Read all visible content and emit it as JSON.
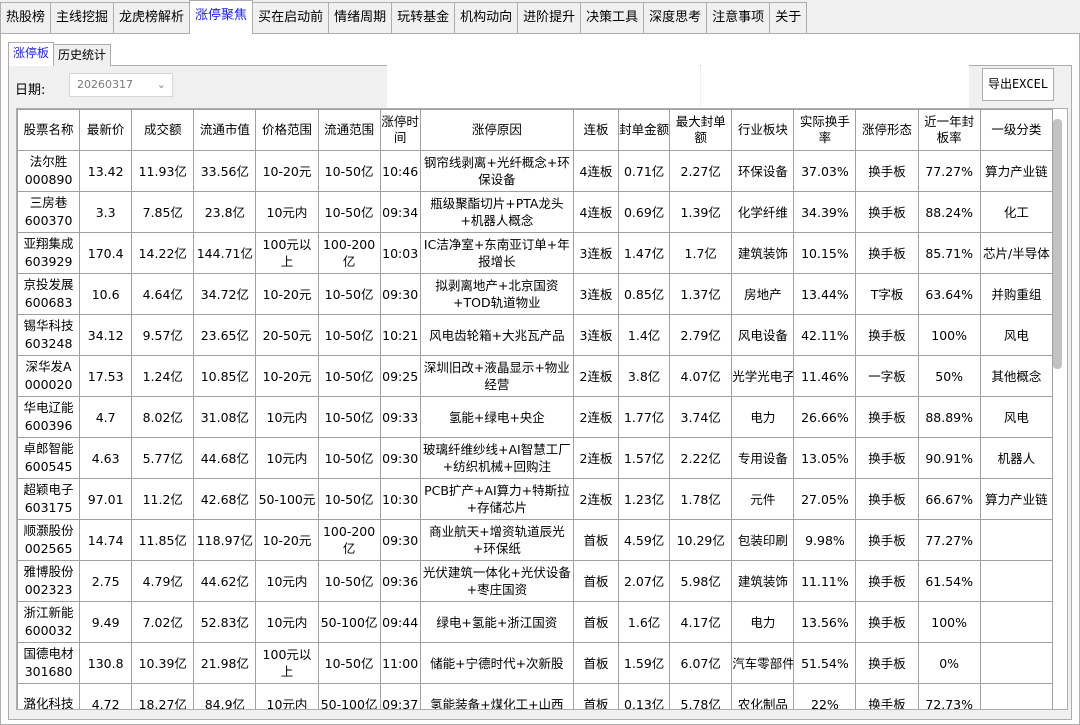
{
  "main_tabs": [
    "热股榜",
    "主线挖掘",
    "龙虎榜解析",
    "涨停聚焦",
    "买在启动前",
    "情绪周期",
    "玩转基金",
    "机构动向",
    "进阶提升",
    "决策工具",
    "深度思考",
    "注意事项",
    "关于"
  ],
  "active_main_tab": 3,
  "sub_tabs": [
    "涨停板",
    "历史统计"
  ],
  "active_sub_tab": 0,
  "date_label": "日期:",
  "date_value": "20260317",
  "export_label": "导出EXCEL",
  "columns": [
    "股票名称",
    "最新价",
    "成交额",
    "流通市值",
    "价格范围",
    "流通范围",
    "涨停时间",
    "涨停原因",
    "连板",
    "封单金额",
    "最大封单额",
    "行业板块",
    "实际换手率",
    "涨停形态",
    "近一年封板率",
    "一级分类"
  ],
  "rows": [
    [
      "法尔胜",
      "000890",
      "13.42",
      "11.93亿",
      "33.56亿",
      "10-20元",
      "10-50亿",
      "10:46",
      "钢帘线剥离+光纤概念+环保设备",
      "4连板",
      "0.71亿",
      "2.27亿",
      "环保设备",
      "37.03%",
      "换手板",
      "77.27%",
      "算力产业链"
    ],
    [
      "三房巷",
      "600370",
      "3.3",
      "7.85亿",
      "23.8亿",
      "10元内",
      "10-50亿",
      "09:34",
      "瓶级聚酯切片+PTA龙头+机器人概念",
      "4连板",
      "0.69亿",
      "1.39亿",
      "化学纤维",
      "34.39%",
      "换手板",
      "88.24%",
      "化工"
    ],
    [
      "亚翔集成",
      "603929",
      "170.4",
      "14.22亿",
      "144.71亿",
      "100元以上",
      "100-200亿",
      "10:03",
      "IC洁净室+东南亚订单+年报增长",
      "3连板",
      "1.47亿",
      "1.7亿",
      "建筑装饰",
      "10.15%",
      "换手板",
      "85.71%",
      "芯片/半导体"
    ],
    [
      "京投发展",
      "600683",
      "10.6",
      "4.64亿",
      "34.72亿",
      "10-20元",
      "10-50亿",
      "09:30",
      "拟剥离地产+北京国资+TOD轨道物业",
      "3连板",
      "0.85亿",
      "1.37亿",
      "房地产",
      "13.44%",
      "T字板",
      "63.64%",
      "并购重组"
    ],
    [
      "锡华科技",
      "603248",
      "34.12",
      "9.57亿",
      "23.65亿",
      "20-50元",
      "10-50亿",
      "10:21",
      "风电齿轮箱+大兆瓦产品",
      "3连板",
      "1.4亿",
      "2.79亿",
      "风电设备",
      "42.11%",
      "换手板",
      "100%",
      "风电"
    ],
    [
      "深华发A",
      "000020",
      "17.53",
      "1.24亿",
      "10.85亿",
      "10-20元",
      "10-50亿",
      "09:25",
      "深圳旧改+液晶显示+物业经营",
      "2连板",
      "3.8亿",
      "4.07亿",
      "光学光电子",
      "11.46%",
      "一字板",
      "50%",
      "其他概念"
    ],
    [
      "华电辽能",
      "600396",
      "4.7",
      "8.02亿",
      "31.08亿",
      "10元内",
      "10-50亿",
      "09:33",
      "氢能+绿电+央企",
      "2连板",
      "1.77亿",
      "3.74亿",
      "电力",
      "26.66%",
      "换手板",
      "88.89%",
      "风电"
    ],
    [
      "卓郎智能",
      "600545",
      "4.63",
      "5.77亿",
      "44.68亿",
      "10元内",
      "10-50亿",
      "09:30",
      "玻璃纤维纱线+AI智慧工厂+纺织机械+回购注",
      "2连板",
      "1.57亿",
      "2.22亿",
      "专用设备",
      "13.05%",
      "换手板",
      "90.91%",
      "机器人"
    ],
    [
      "超颖电子",
      "603175",
      "97.01",
      "11.2亿",
      "42.68亿",
      "50-100元",
      "10-50亿",
      "10:30",
      "PCB扩产+AI算力+特斯拉+存储芯片",
      "2连板",
      "1.23亿",
      "1.78亿",
      "元件",
      "27.05%",
      "换手板",
      "66.67%",
      "算力产业链"
    ],
    [
      "顺灏股份",
      "002565",
      "14.74",
      "11.85亿",
      "118.97亿",
      "10-20元",
      "100-200亿",
      "09:30",
      "商业航天+增资轨道辰光+环保纸",
      "首板",
      "4.59亿",
      "10.29亿",
      "包装印刷",
      "9.98%",
      "换手板",
      "77.27%",
      ""
    ],
    [
      "雅博股份",
      "002323",
      "2.75",
      "4.79亿",
      "44.62亿",
      "10元内",
      "10-50亿",
      "09:36",
      "光伏建筑一体化+光伏设备+枣庄国资",
      "首板",
      "2.07亿",
      "5.98亿",
      "建筑装饰",
      "11.11%",
      "换手板",
      "61.54%",
      ""
    ],
    [
      "浙江新能",
      "600032",
      "9.49",
      "7.02亿",
      "52.83亿",
      "10元内",
      "50-100亿",
      "09:44",
      "绿电+氢能+浙江国资",
      "首板",
      "1.6亿",
      "4.17亿",
      "电力",
      "13.56%",
      "换手板",
      "100%",
      ""
    ],
    [
      "国德电材",
      "301680",
      "130.8",
      "10.39亿",
      "21.98亿",
      "100元以上",
      "10-50亿",
      "11:00",
      "储能+宁德时代+次新股",
      "首板",
      "1.59亿",
      "6.07亿",
      "汽车零部件",
      "51.54%",
      "换手板",
      "0%",
      ""
    ],
    [
      "潞化科技",
      "",
      "4.72",
      "18.27亿",
      "84.9亿",
      "10元内",
      "50-100亿",
      "09:37",
      "氢能装备+煤化工+山西",
      "首板",
      "0.13亿",
      "5.78亿",
      "农化制品",
      "22%",
      "换手板",
      "72.73%",
      ""
    ]
  ]
}
